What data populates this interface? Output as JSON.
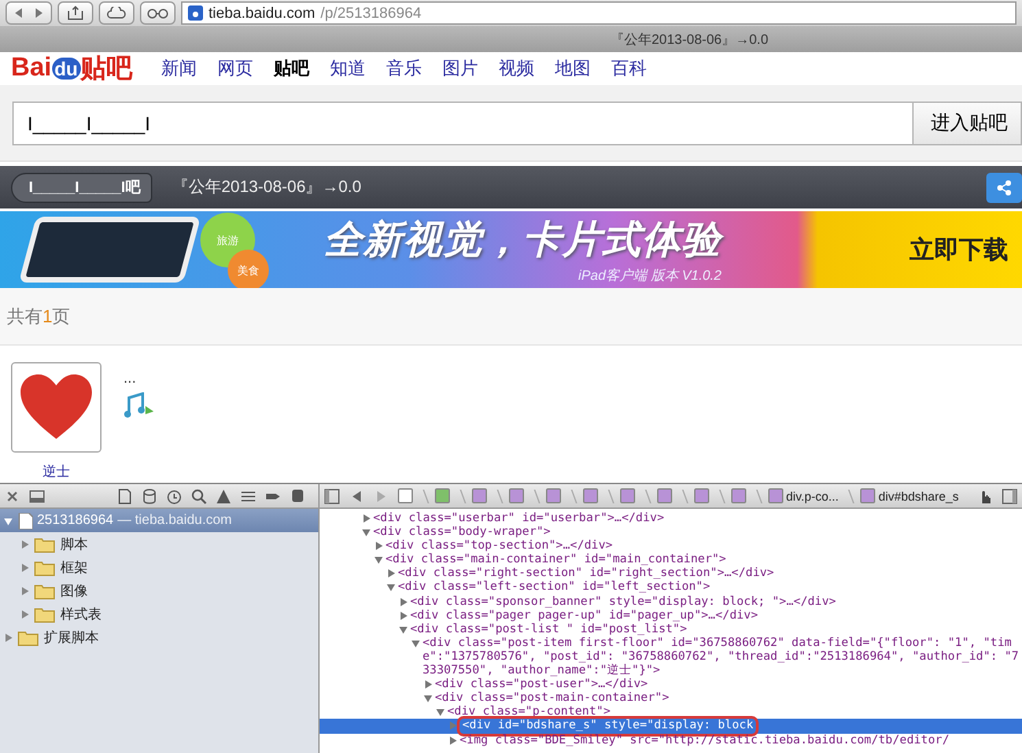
{
  "browser": {
    "url_host": "tieba.baidu.com",
    "url_path": "/p/2513186964",
    "title": "『公年2013-08-06』→0.0"
  },
  "logo": {
    "text": "Bai",
    "badge": "du",
    "product": "贴吧"
  },
  "nav": [
    {
      "label": "新闻",
      "selected": false
    },
    {
      "label": "网页",
      "selected": false
    },
    {
      "label": "贴吧",
      "selected": true
    },
    {
      "label": "知道",
      "selected": false
    },
    {
      "label": "音乐",
      "selected": false
    },
    {
      "label": "图片",
      "selected": false
    },
    {
      "label": "视频",
      "selected": false
    },
    {
      "label": "地图",
      "selected": false
    },
    {
      "label": "百科",
      "selected": false
    }
  ],
  "search": {
    "value": "I_____I_____I",
    "button": "进入贴吧"
  },
  "thread_bar": {
    "back": "I_____I_____I吧",
    "title": "『公年2013-08-06』→0.0"
  },
  "banner": {
    "headline": "全新视觉，卡片式体验",
    "subline": "iPad客户端 版本 V1.0.2",
    "cta": "立即下载",
    "bubble_top": "旅游",
    "bubble_bottom": "美食"
  },
  "pager": {
    "prefix": "共有",
    "count": "1",
    "suffix": "页"
  },
  "post": {
    "author": "逆士",
    "content": "..."
  },
  "devtools": {
    "resources": [
      {
        "label": "2513186964",
        "host": "— tieba.baidu.com",
        "expanded": true,
        "selected": true,
        "children": [
          {
            "label": "脚本",
            "expanded": false,
            "selected": false
          },
          {
            "label": "框架",
            "expanded": false,
            "selected": false
          },
          {
            "label": "图像",
            "expanded": false,
            "selected": false
          },
          {
            "label": "样式表",
            "expanded": false,
            "selected": false
          }
        ]
      },
      {
        "label": "扩展脚本",
        "expanded": false,
        "selected": false
      }
    ],
    "crumbs": [
      {
        "kind": "doc"
      },
      {
        "kind": "html"
      },
      {
        "kind": "el"
      },
      {
        "kind": "el"
      },
      {
        "kind": "el"
      },
      {
        "kind": "el"
      },
      {
        "kind": "el"
      },
      {
        "kind": "el"
      },
      {
        "kind": "el"
      },
      {
        "kind": "el"
      },
      {
        "kind": "el",
        "label": "div.p-co..."
      },
      {
        "kind": "el",
        "label": "div#bdshare_s"
      }
    ],
    "dom": [
      {
        "text": "<div class=\"userbar\" id=\"userbar\">…</div>",
        "expanded": false,
        "selected": false
      },
      {
        "text": "<div class=\"body-wraper\">",
        "expanded": true,
        "selected": false,
        "children": [
          {
            "text": "<div class=\"top-section\">…</div>",
            "expanded": false,
            "selected": false
          },
          {
            "text": "<div class=\"main-container\" id=\"main_container\">",
            "expanded": true,
            "selected": false,
            "children": [
              {
                "text": "<div class=\"right-section\" id=\"right_section\">…</div>",
                "expanded": false,
                "selected": false
              },
              {
                "text": "<div class=\"left-section\" id=\"left_section\">",
                "expanded": true,
                "selected": false,
                "children": [
                  {
                    "text": "<div class=\"sponsor_banner\" style=\"display: block; \">…</div>",
                    "expanded": false,
                    "selected": false
                  },
                  {
                    "text": "<div class=\"pager pager-up\" id=\"pager_up\">…</div>",
                    "expanded": false,
                    "selected": false
                  },
                  {
                    "text": "<div class=\"post-list \" id=\"post_list\">",
                    "expanded": true,
                    "selected": false,
                    "children": [
                      {
                        "text": "<div class=\"post-item first-floor\" id=\"36758860762\" data-field=\"{\"floor\": \"1\", \"time\":\"1375780576\", \"post_id\": \"36758860762\", \"thread_id\":\"2513186964\", \"author_id\": \"733307550\", \"author_name\":\"逆士\"}\">",
                        "expanded": true,
                        "selected": false,
                        "children": [
                          {
                            "text": "<div class=\"post-user\">…</div>",
                            "expanded": false,
                            "selected": false
                          },
                          {
                            "text": "<div class=\"post-main-container\">",
                            "expanded": true,
                            "selected": false,
                            "children": [
                              {
                                "text": "<div class=\"p-content\">",
                                "expanded": true,
                                "selected": false,
                                "children": [
                                  {
                                    "text": "<div id=\"bdshare_s\" style=\"display: block",
                                    "expanded": false,
                                    "selected": true
                                  },
                                  {
                                    "text": "<img class=\"BDE_Smiley\" src=\"http://static.tieba.baidu.com/tb/editor/",
                                    "expanded": false,
                                    "selected": false
                                  }
                                ]
                              }
                            ]
                          }
                        ]
                      }
                    ]
                  }
                ]
              }
            ]
          }
        ]
      }
    ]
  }
}
